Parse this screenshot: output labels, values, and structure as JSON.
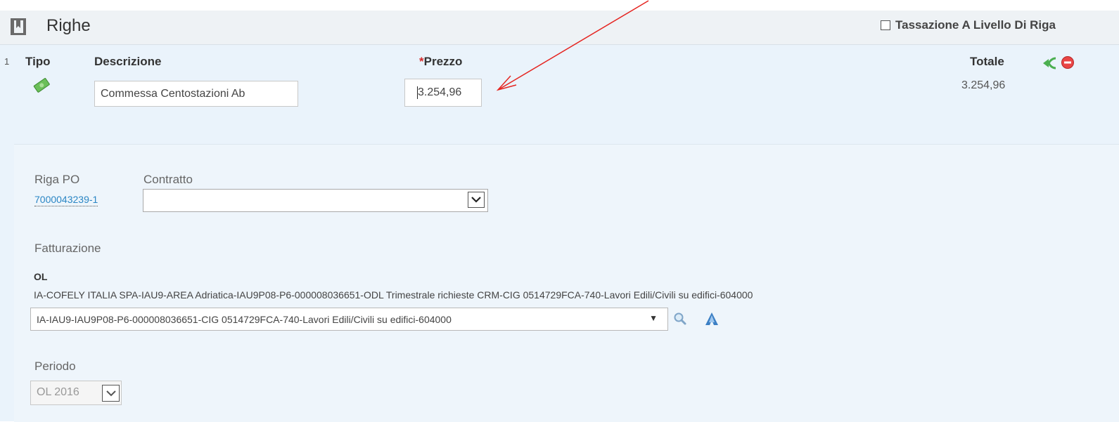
{
  "header": {
    "title": "Righe",
    "tax_checkbox_label": "Tassazione A Livello Di Riga",
    "tax_checked": false
  },
  "line": {
    "number": "1",
    "columns": {
      "tipo": "Tipo",
      "descrizione": "Descrizione",
      "prezzo_required": "*",
      "prezzo": "Prezzo",
      "totale": "Totale"
    },
    "descrizione_value": "Commessa Centostazioni Ab",
    "prezzo_value": "3.254,96",
    "totale_value": "3.254,96"
  },
  "details": {
    "riga_po_label": "Riga PO",
    "riga_po_value": "7000043239-1",
    "contratto_label": "Contratto",
    "contratto_value": "",
    "fatturazione_label": "Fatturazione",
    "fatturazione_code": "OL",
    "fatturazione_desc": "IA-COFELY ITALIA SPA-IAU9-AREA Adriatica-IAU9P08-P6-000008036651-ODL Trimestrale richieste CRM-CIG 0514729FCA-740-Lavori Edili/Civili su edifici-604000",
    "fatturazione_select": "IA-IAU9-IAU9P08-P6-000008036651-CIG 0514729FCA-740-Lavori Edili/Civili su edifici-604000",
    "periodo_label": "Periodo",
    "periodo_value": "OL 2016"
  },
  "colors": {
    "accent_link": "#2b86c4",
    "required": "#d62b2b",
    "annotation_arrow": "#e52521",
    "panel_bg": "#eaf3fb"
  },
  "icons": [
    "book-icon",
    "money-icon",
    "split-line-icon",
    "remove-line-icon",
    "search-icon",
    "hierarchy-icon",
    "chevron-down-icon"
  ]
}
